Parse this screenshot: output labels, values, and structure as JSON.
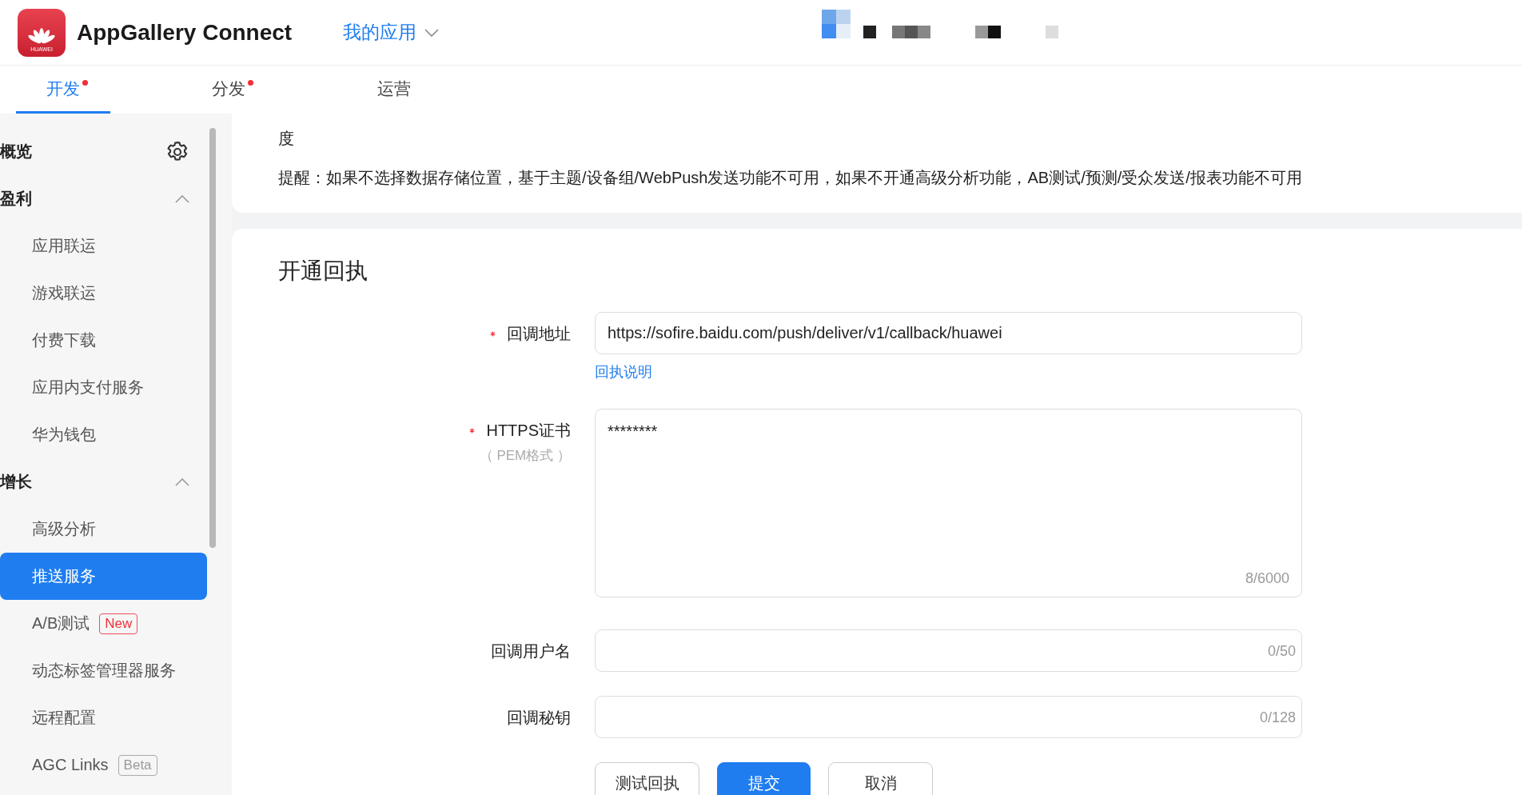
{
  "header": {
    "logo_text": "HUAWEI",
    "title": "AppGallery Connect",
    "app_menu": "我的应用"
  },
  "tabs": [
    {
      "label": "开发",
      "selected": true,
      "dot": true
    },
    {
      "label": "分发",
      "selected": false,
      "dot": true
    },
    {
      "label": "运营",
      "selected": false,
      "dot": false
    }
  ],
  "sidebar": {
    "items": [
      {
        "kind": "link",
        "label": "概览"
      },
      {
        "kind": "group",
        "label": "盈利",
        "expanded": true,
        "children": [
          {
            "label": "应用联运",
            "selected": false
          },
          {
            "label": "游戏联运",
            "selected": false
          },
          {
            "label": "付费下载",
            "selected": false
          },
          {
            "label": "应用内支付服务",
            "selected": false
          },
          {
            "label": "华为钱包",
            "selected": false
          }
        ]
      },
      {
        "kind": "group",
        "label": "增长",
        "expanded": true,
        "children": [
          {
            "label": "高级分析",
            "selected": false
          },
          {
            "label": "推送服务",
            "selected": true
          },
          {
            "label": "A/B测试",
            "selected": false,
            "badge": {
              "kind": "new",
              "text": "New"
            }
          },
          {
            "label": "动态标签管理器服务",
            "selected": false
          },
          {
            "label": "远程配置",
            "selected": false
          },
          {
            "label": "AGC Links",
            "selected": false,
            "badge": {
              "kind": "beta",
              "text": "Beta"
            }
          }
        ]
      }
    ]
  },
  "notice": {
    "line": "度",
    "reminder": "提醒：如果不选择数据存储位置，基于主题/设备组/WebPush发送功能不可用，如果不开通高级分析功能，AB测试/预测/受众发送/报表功能不可用"
  },
  "form": {
    "title": "开通回执",
    "fields": [
      {
        "kind": "input",
        "label": "回调地址",
        "required": true,
        "value": "https://sofire.baidu.com/push/deliver/v1/callback/huawei",
        "link": "回执说明"
      },
      {
        "kind": "textarea",
        "label": "HTTPS证书",
        "sublabel": "（ PEM格式 ）",
        "required": true,
        "value": "********",
        "counter": "8/6000"
      },
      {
        "kind": "input",
        "label": "回调用户名",
        "required": false,
        "counter": "0/50"
      },
      {
        "kind": "input",
        "label": "回调秘钥",
        "required": false,
        "counter": "0/128"
      }
    ],
    "buttons": [
      {
        "label": "测试回执",
        "primary": false
      },
      {
        "label": "提交",
        "primary": true
      },
      {
        "label": "取消",
        "primary": false
      }
    ]
  }
}
